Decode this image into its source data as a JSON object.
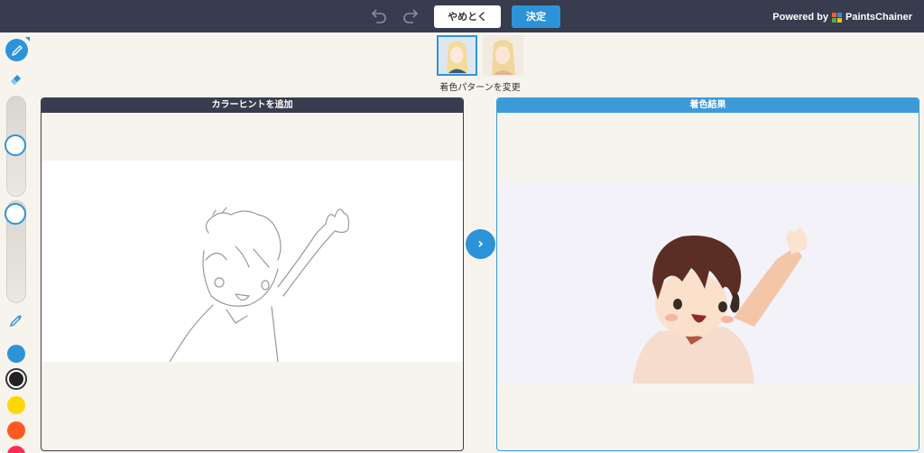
{
  "topbar": {
    "cancel_label": "やめとく",
    "ok_label": "決定",
    "powered_by": "Powered by",
    "brand": "PaintsChainer"
  },
  "toolbar": {
    "tools": [
      "pen-icon",
      "eraser-icon",
      "eyedropper-icon"
    ],
    "brush_size_level": 0.45,
    "opacity_level": 0.1,
    "colors": [
      "#2d93d9",
      "#222222",
      "#ffd700",
      "#ff5a1f",
      "#ff2a55"
    ],
    "selected_color": "#222222"
  },
  "thumbnails": {
    "caption": "着色パターンを変更",
    "selected_index": 0
  },
  "left_panel": {
    "title": "カラーヒントを追加"
  },
  "right_panel": {
    "title": "着色結果"
  },
  "colors": {
    "accent": "#2d93d9",
    "dark": "#373c4f",
    "background": "#f7f4ee"
  }
}
